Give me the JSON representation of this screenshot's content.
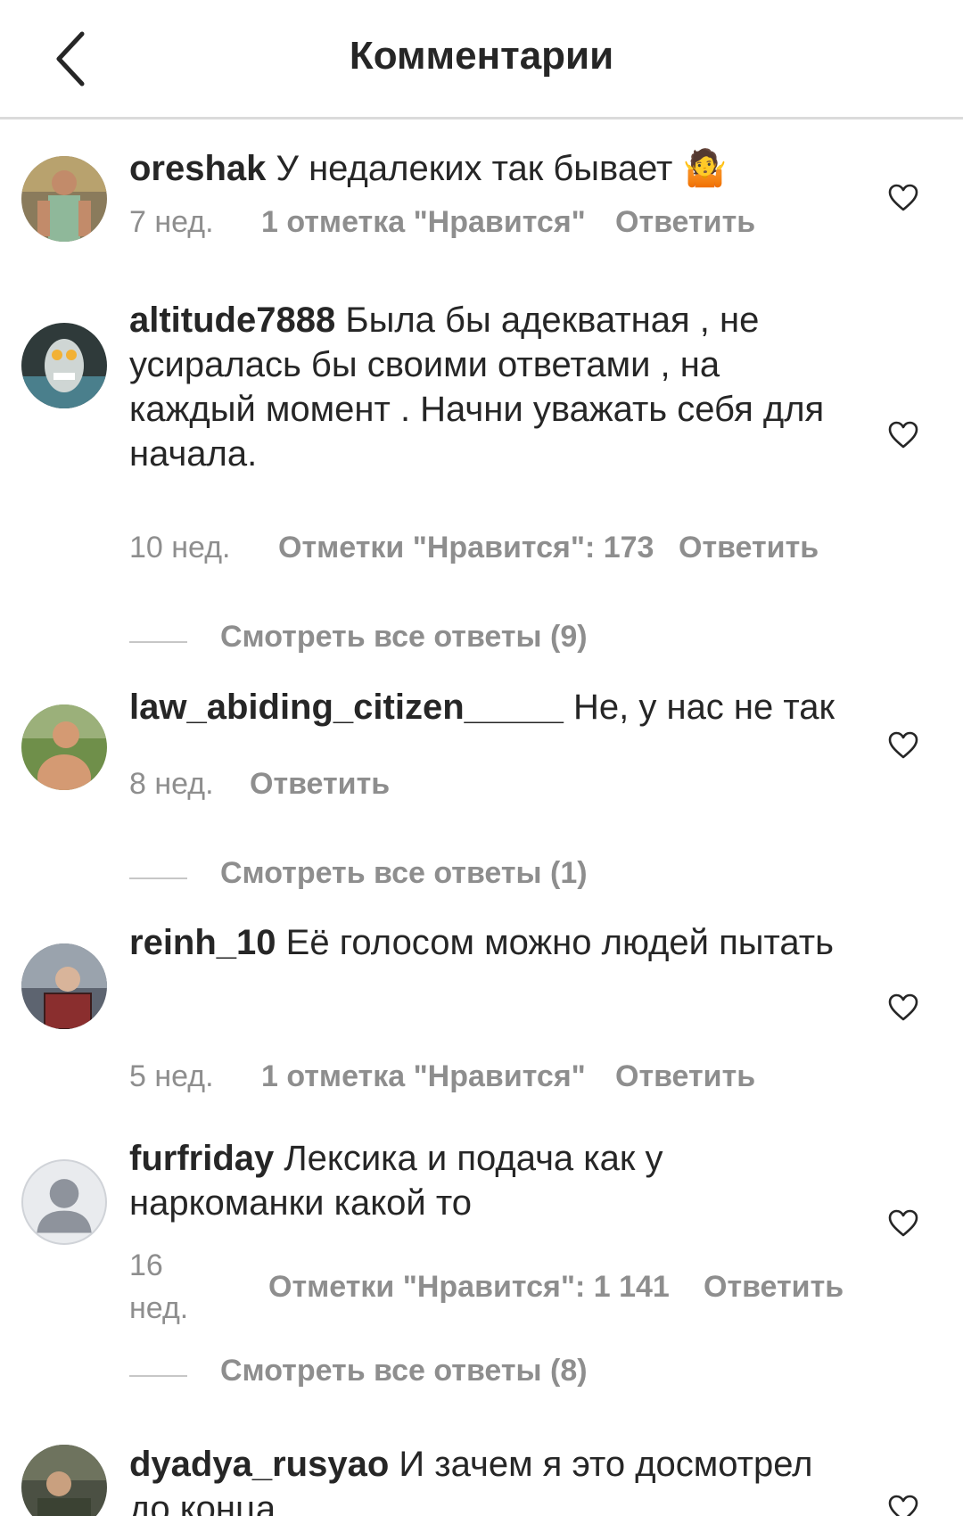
{
  "header": {
    "title": "Комментарии"
  },
  "comments": [
    {
      "username": "oreshak",
      "text": "У недалеких так бывает",
      "emoji": "🤷",
      "time": "7 нед.",
      "likes": "1 отметка \"Нравится\"",
      "reply": "Ответить"
    },
    {
      "username": "altitude7888",
      "text": "Была бы адекватная , не усиралась бы своими ответами , на каждый момент . Начни уважать себя для начала.",
      "time": "10 нед.",
      "likes": "Отметки \"Нравится\": 173",
      "reply": "Ответить",
      "view_replies": "Смотреть все ответы (9)"
    },
    {
      "username": "law_abiding_citizen_____",
      "text": "Не, у нас не так",
      "time": "8 нед.",
      "reply": "Ответить",
      "view_replies": "Смотреть все ответы (1)"
    },
    {
      "username": "reinh_10",
      "text": "Её голосом можно людей пытать",
      "time": "5 нед.",
      "likes": "1 отметка \"Нравится\"",
      "reply": "Ответить"
    },
    {
      "username": "furfriday",
      "text": "Лексика и подача как у наркоманки какой то",
      "time_line1": "16",
      "time_line2": "нед.",
      "likes": "Отметки \"Нравится\": 1 141",
      "reply": "Ответить",
      "view_replies": "Смотреть все ответы (8)"
    },
    {
      "username": "dyadya_rusyao",
      "text": "И зачем я это досмотрел до конца"
    }
  ],
  "icons": {
    "back": "chevron-left-icon",
    "like": "heart-outline-icon",
    "default_avatar": "default-avatar-icon"
  }
}
